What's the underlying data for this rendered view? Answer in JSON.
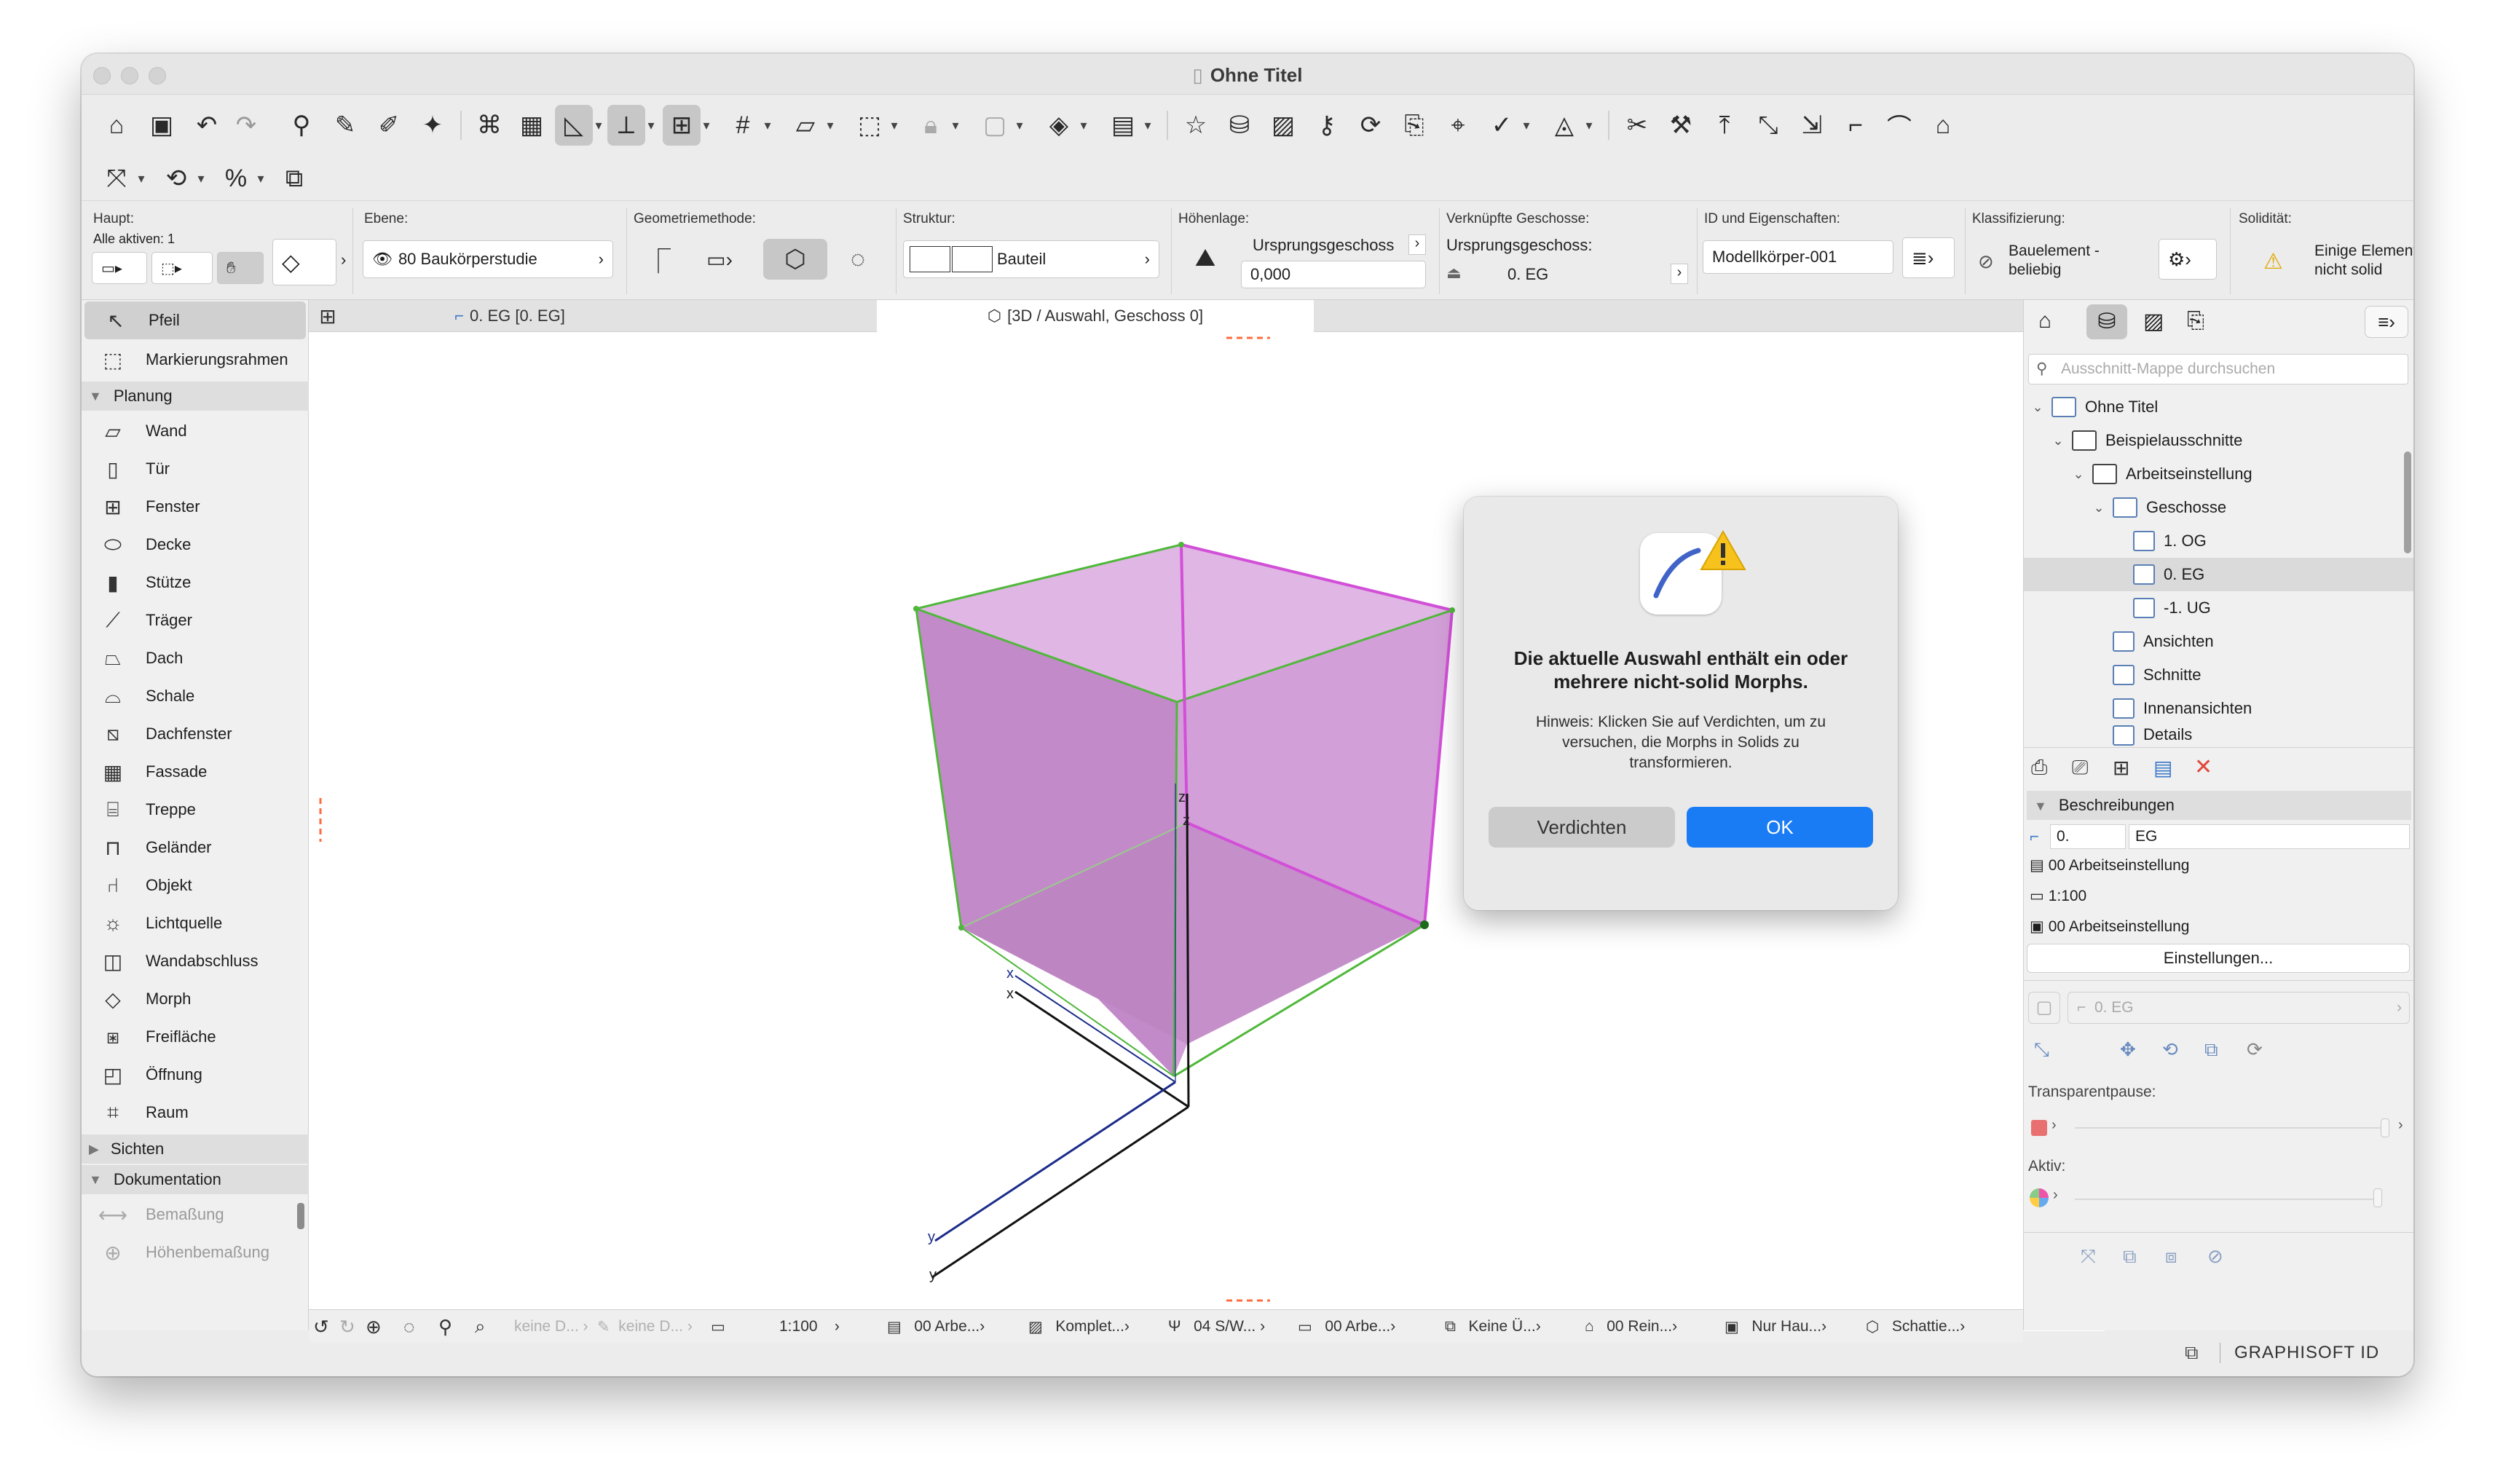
{
  "window": {
    "title": "Ohne Titel"
  },
  "infobox": {
    "haupt_label": "Haupt:",
    "alle_aktiven": "Alle aktiven: 1",
    "ebene_label": "Ebene:",
    "ebene_value": "80 Baukörperstudie",
    "geometrie_label": "Geometriemethode:",
    "struktur_label": "Struktur:",
    "struktur_value": "Bauteil",
    "hoehen_label": "Höhenlage:",
    "hoehen_ref": "Ursprungsgeschoss",
    "hoehen_value": "0,000",
    "verkn_label": "Verknüpfte Geschosse:",
    "verkn_sub": "Ursprungsgeschoss:",
    "verkn_value": "0. EG",
    "id_label": "ID und Eigenschaften:",
    "id_value": "Modellkörper-001",
    "klass_label": "Klassifizierung:",
    "klass_line1": "Bauelement -",
    "klass_line2": "beliebig",
    "solid_label": "Solidität:",
    "solid_line1": "Einige Elemente",
    "solid_line2": "nicht solid"
  },
  "toolbox": {
    "pfeil": "Pfeil",
    "markierungsrahmen": "Markierungsrahmen",
    "planung": "Planung",
    "wand": "Wand",
    "tuer": "Tür",
    "fenster": "Fenster",
    "decke": "Decke",
    "stuetze": "Stütze",
    "traeger": "Träger",
    "dach": "Dach",
    "schale": "Schale",
    "dachfenster": "Dachfenster",
    "fassade": "Fassade",
    "treppe": "Treppe",
    "gelaender": "Geländer",
    "objekt": "Objekt",
    "lichtquelle": "Lichtquelle",
    "wandabschluss": "Wandabschluss",
    "morph": "Morph",
    "freiflaeche": "Freifläche",
    "oeffnung": "Öffnung",
    "raum": "Raum",
    "sichten": "Sichten",
    "dokumentation": "Dokumentation",
    "bemassung": "Bemaßung",
    "hoehenbemassung": "Höhenbemaßung"
  },
  "tabs": {
    "floorplan": "0. EG [0. EG]",
    "view3d": "[3D / Auswahl, Geschoss 0]"
  },
  "canvas": {
    "axis_x": "x",
    "axis_y": "y",
    "axis_z": "z"
  },
  "dialog": {
    "title": "Die aktuelle Auswahl enthält ein oder mehrere nicht-solid Morphs.",
    "message": "Hinweis: Klicken Sie auf Verdichten, um zu versuchen, die Morphs in Solids zu transformieren.",
    "btn_secondary": "Verdichten",
    "btn_primary": "OK"
  },
  "navigator": {
    "search_placeholder": "Ausschnitt-Mappe durchsuchen",
    "tree": {
      "root": "Ohne Titel",
      "beispiel": "Beispielausschnitte",
      "arbeit": "Arbeitseinstellung",
      "geschosse": "Geschosse",
      "og1": "1. OG",
      "eg0": "0. EG",
      "ug1": "-1. UG",
      "ansichten": "Ansichten",
      "schnitte": "Schnitte",
      "innen": "Innenansichten",
      "details": "Details"
    },
    "beschreibungen": "Beschreibungen",
    "desc_num": "0.",
    "desc_name": "EG",
    "layer_combo": "00 Arbeitseinstellung",
    "scale": "1:100",
    "model_view": "00 Arbeitseinstellung",
    "einstellungen": "Einstellungen...",
    "view_field": "0. EG",
    "transparent_label": "Transparentpause:",
    "aktiv_label": "Aktiv:",
    "graphisoft": "GRAPHISOFT ID"
  },
  "statusbar": {
    "keine1": "keine D...",
    "keine2": "keine D...",
    "scale": "1:100",
    "arbe1": "00 Arbe...",
    "komplet": "Komplet...",
    "sw": "04 S/W...",
    "arbe2": "00 Arbe...",
    "keine_u": "Keine Ü...",
    "rein": "00 Rein...",
    "nur_hau": "Nur Hau...",
    "schattie": "Schattie..."
  },
  "colors": {
    "accent": "#0a7aff",
    "morph_fill": "#c98ed0",
    "morph_edge_green": "#4fb83a",
    "morph_edge_magenta": "#d24fd8"
  }
}
